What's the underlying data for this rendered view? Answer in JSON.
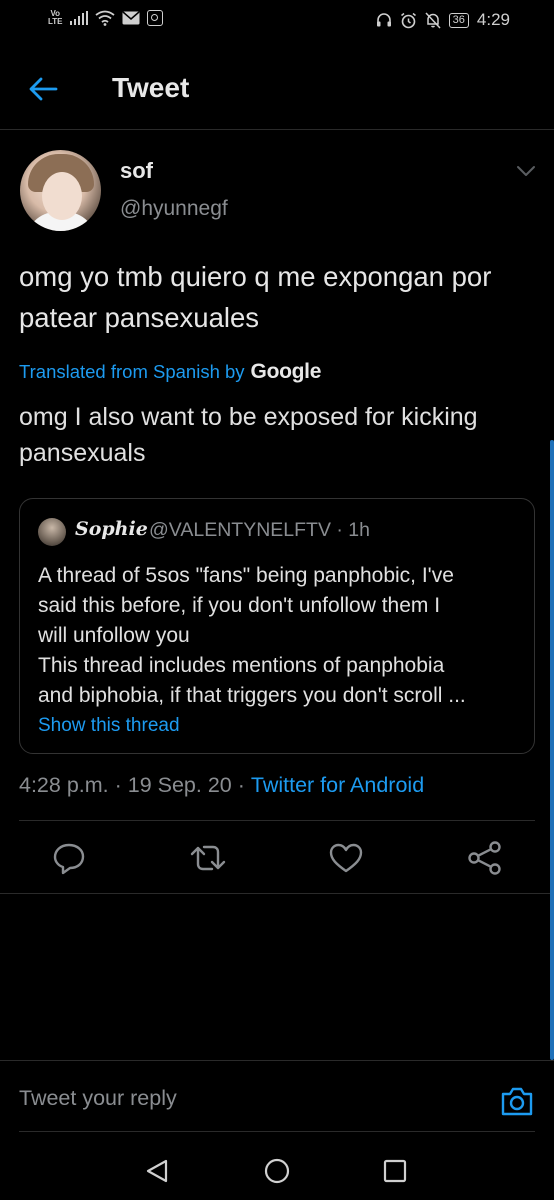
{
  "status_bar": {
    "volte_top": "Vo",
    "volte_bottom": "LTE",
    "battery": "36",
    "time": "4:29",
    "icons": [
      "signal-icon",
      "wifi-icon",
      "mail-icon",
      "instagram-icon",
      "headphones-icon",
      "alarm-icon",
      "mute-icon",
      "battery-icon"
    ]
  },
  "header": {
    "title": "Tweet"
  },
  "tweet": {
    "display_name": "sof",
    "handle": "@hyunnegf",
    "text": "omg yo tmb quiero q me expongan por patear pansexuales",
    "translated_label": "Translated from Spanish by",
    "translated_provider": "Google",
    "translation": "omg I also want to be exposed for kicking pansexuals",
    "timestamp": "4:28 p.m. · 19 Sep. 20 ·",
    "client": "Twitter for Android"
  },
  "quote": {
    "name": "Sophie",
    "handle": "@VALENTYNELFTV · 1h",
    "lines": [
      "A thread of 5sos \"fans\" being panphobic, I've",
      "said this before, if you don't unfollow them I",
      "will unfollow you",
      "This thread includes mentions of panphobia",
      "and biphobia, if that triggers you don't scroll ..."
    ],
    "show_thread": "Show this thread"
  },
  "reply": {
    "placeholder": "Tweet your reply"
  },
  "colors": {
    "accent": "#1d9bf0",
    "muted": "#8a8d91",
    "background": "#000000"
  }
}
